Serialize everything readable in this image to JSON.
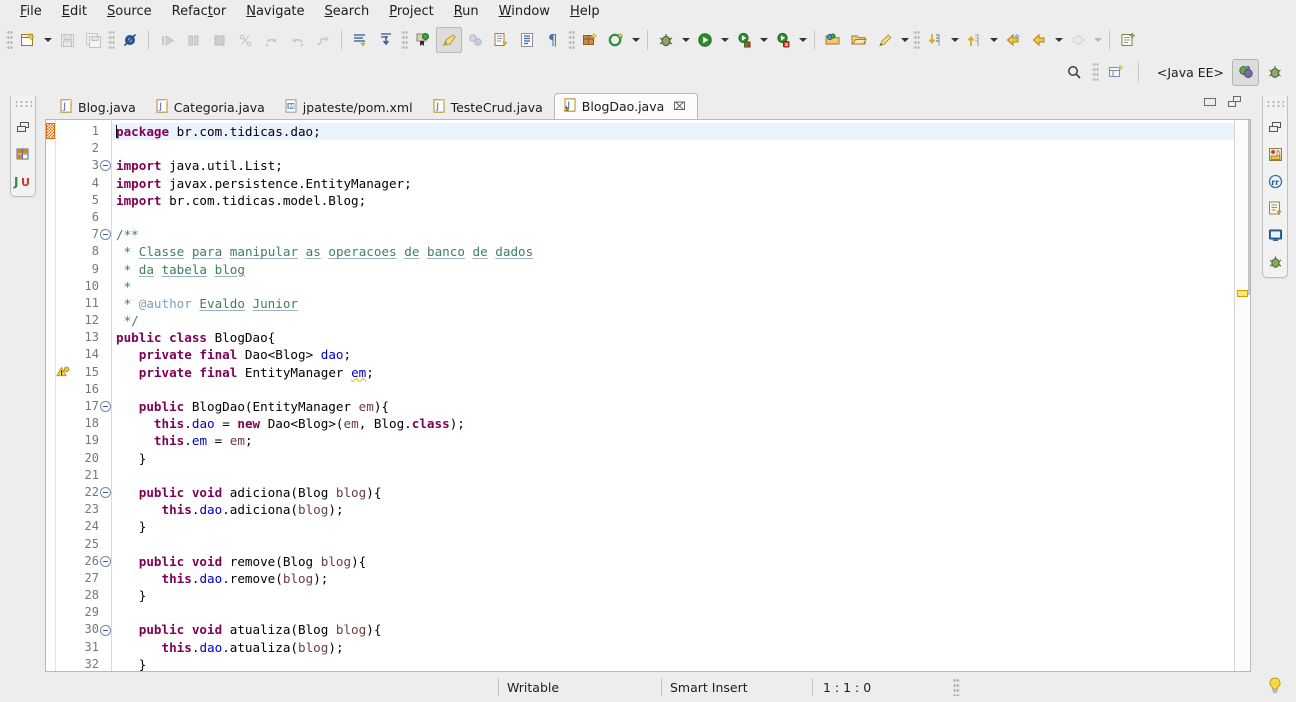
{
  "window": {
    "app": "Eclipse IDE",
    "perspective_label": "<Java EE>"
  },
  "menubar": {
    "items": [
      {
        "label": "File",
        "mnemonic": "F"
      },
      {
        "label": "Edit",
        "mnemonic": "E"
      },
      {
        "label": "Source",
        "mnemonic": "S"
      },
      {
        "label": "Refactor",
        "mnemonic": "t"
      },
      {
        "label": "Navigate",
        "mnemonic": "N"
      },
      {
        "label": "Search",
        "mnemonic": "S"
      },
      {
        "label": "Project",
        "mnemonic": "P"
      },
      {
        "label": "Run",
        "mnemonic": "R"
      },
      {
        "label": "Window",
        "mnemonic": "W"
      },
      {
        "label": "Help",
        "mnemonic": "H"
      }
    ]
  },
  "toolbar": {
    "groups": [
      {
        "name": "file",
        "buttons": [
          {
            "icon": "new-wizard-icon",
            "enabled": true,
            "dropdown": true
          },
          {
            "icon": "save-icon",
            "enabled": false
          },
          {
            "icon": "save-all-icon",
            "enabled": false
          }
        ]
      },
      {
        "name": "validate",
        "buttons": [
          {
            "icon": "skip-all-breakpoints-icon",
            "enabled": true
          }
        ]
      },
      {
        "name": "debug-controls",
        "buttons": [
          {
            "icon": "resume-icon",
            "enabled": false
          },
          {
            "icon": "suspend-icon",
            "enabled": false
          },
          {
            "icon": "terminate-icon",
            "enabled": false
          },
          {
            "icon": "step-into-icon",
            "enabled": false
          },
          {
            "icon": "step-over-icon",
            "enabled": false
          },
          {
            "icon": "step-return-icon",
            "enabled": false
          },
          {
            "icon": "drop-to-frame-icon",
            "enabled": false
          }
        ]
      },
      {
        "name": "annotations",
        "buttons": [
          {
            "icon": "next-annotation-icon",
            "enabled": true
          },
          {
            "icon": "previous-annotation-icon",
            "enabled": true
          }
        ]
      },
      {
        "name": "markers",
        "buttons": [
          {
            "icon": "add-bookmark-icon",
            "enabled": true
          },
          {
            "icon": "toggle-mark-occurrences-icon",
            "enabled": true,
            "selected": true
          },
          {
            "icon": "restore-last-selection-icon",
            "enabled": false
          },
          {
            "icon": "open-task-icon",
            "enabled": true
          },
          {
            "icon": "show-whitespace-icon",
            "enabled": true
          },
          {
            "icon": "show-print-margin-icon",
            "enabled": true
          }
        ]
      },
      {
        "name": "java",
        "buttons": [
          {
            "icon": "new-java-package-icon",
            "enabled": true
          },
          {
            "icon": "new-java-class-icon",
            "enabled": true,
            "dropdown": true
          }
        ]
      },
      {
        "name": "launch",
        "buttons": [
          {
            "icon": "debug-icon",
            "enabled": true,
            "dropdown": true
          },
          {
            "icon": "run-icon",
            "enabled": true,
            "dropdown": true
          },
          {
            "icon": "run-external-tools-icon",
            "enabled": true,
            "dropdown": true
          },
          {
            "icon": "profile-icon",
            "enabled": true,
            "dropdown": true
          }
        ]
      },
      {
        "name": "resources",
        "buttons": [
          {
            "icon": "open-type-icon",
            "enabled": true
          },
          {
            "icon": "open-task-resource-icon",
            "enabled": true
          },
          {
            "icon": "new-edit-icon",
            "enabled": true,
            "dropdown": true
          }
        ]
      },
      {
        "name": "navigation",
        "buttons": [
          {
            "icon": "next-edit-location-icon",
            "enabled": true,
            "dropdown": true
          },
          {
            "icon": "previous-edit-location-icon",
            "enabled": true,
            "dropdown": true
          },
          {
            "icon": "back-icon",
            "enabled": true
          },
          {
            "icon": "forward-icon",
            "enabled": true,
            "dropdown": true
          },
          {
            "icon": "forward-disabled-icon",
            "enabled": false,
            "dropdown": true
          }
        ]
      },
      {
        "name": "misc",
        "buttons": [
          {
            "icon": "new-annotation-icon",
            "enabled": true
          }
        ]
      }
    ]
  },
  "perspective_bar": {
    "search_icon": "search-icon",
    "open-perspective_icon": "open-perspective-icon",
    "label": "<Java EE>",
    "perspectives": [
      {
        "name": "java-ee-perspective",
        "icon": "java-ee-icon",
        "active": true
      },
      {
        "name": "debug-perspective",
        "icon": "debug-perspective-icon",
        "active": false
      }
    ]
  },
  "left_rail": {
    "icons": [
      {
        "name": "restore-view-icon"
      },
      {
        "name": "project-explorer-icon"
      },
      {
        "name": "junit-icon",
        "label": "JU"
      }
    ]
  },
  "right_rail": {
    "icons": [
      {
        "name": "restore-view-icon"
      },
      {
        "name": "task-list-icon"
      },
      {
        "name": "javadoc-icon"
      },
      {
        "name": "snippets-icon"
      },
      {
        "name": "console-icon"
      },
      {
        "name": "servers-icon"
      }
    ]
  },
  "editor": {
    "tabs": [
      {
        "label": "Blog.java",
        "icon": "java-file-icon",
        "active": false,
        "dirty": false
      },
      {
        "label": "Categoria.java",
        "icon": "java-file-icon",
        "active": false,
        "dirty": false
      },
      {
        "label": "jpateste/pom.xml",
        "icon": "maven-file-icon",
        "active": false,
        "dirty": false
      },
      {
        "label": "TesteCrud.java",
        "icon": "java-file-icon",
        "active": false,
        "dirty": false
      },
      {
        "label": "BlogDao.java",
        "icon": "java-file-warning-icon",
        "active": true,
        "dirty": false,
        "close_glyph": "⌧"
      }
    ],
    "controls": [
      {
        "name": "minimize-editor-button"
      },
      {
        "name": "maximize-editor-button"
      }
    ],
    "first_visible_line": 1,
    "last_visible_line": 32,
    "current_line": 1,
    "change_marker_line": 1,
    "warning_marker_line": 15,
    "fold_lines": [
      3,
      7,
      17,
      22,
      26,
      30
    ],
    "lines": [
      {
        "n": 1,
        "html": "<span class=\"caret\"></span><span class=\"kw\">package</span><span class=\"plain\"> br.com.tidicas.dao;</span>",
        "current": true
      },
      {
        "n": 2,
        "html": ""
      },
      {
        "n": 3,
        "html": "<span class=\"kw\">import</span><span class=\"plain\"> java.util.List;</span>",
        "fold": true
      },
      {
        "n": 4,
        "html": "<span class=\"kw\">import</span><span class=\"plain\"> javax.persistence.EntityManager;</span>"
      },
      {
        "n": 5,
        "html": "<span class=\"kw\">import</span><span class=\"plain\"> br.com.tidicas.model.Blog;</span>"
      },
      {
        "n": 6,
        "html": ""
      },
      {
        "n": 7,
        "html": "<span class=\"cmt\">/**</span>",
        "fold": true
      },
      {
        "n": 8,
        "html": "<span class=\"cmt\"> * </span><span class=\"cmt spellu\">Classe</span><span class=\"cmt\"> </span><span class=\"cmt spellu\">para</span><span class=\"cmt\"> </span><span class=\"cmt spellu\">manipular</span><span class=\"cmt\"> </span><span class=\"cmt spellu\">as</span><span class=\"cmt\"> </span><span class=\"cmt spellu\">operacoes</span><span class=\"cmt\"> </span><span class=\"cmt spellu\">de</span><span class=\"cmt\"> </span><span class=\"cmt spellu\">banco</span><span class=\"cmt\"> </span><span class=\"cmt spellu\">de</span><span class=\"cmt\"> </span><span class=\"cmt spellu\">dados</span>"
      },
      {
        "n": 9,
        "html": "<span class=\"cmt\"> * </span><span class=\"cmt spellu\">da</span><span class=\"cmt\"> </span><span class=\"cmt spellu\">tabela</span><span class=\"cmt\"> </span><span class=\"cmt spellu\">blog</span>"
      },
      {
        "n": 10,
        "html": "<span class=\"cmt\"> *</span>"
      },
      {
        "n": 11,
        "html": "<span class=\"cmt\"> * </span><span class=\"jdoc-tag\">@author</span><span class=\"cmt\"> </span><span class=\"cmt spellu\">Evaldo</span><span class=\"cmt\"> </span><span class=\"cmt spellu\">Junior</span>"
      },
      {
        "n": 12,
        "html": "<span class=\"cmt\"> */</span>"
      },
      {
        "n": 13,
        "html": "<span class=\"kw\">public class</span><span class=\"plain\"> BlogDao{</span>"
      },
      {
        "n": 14,
        "html": "<span class=\"plain\">   </span><span class=\"kw\">private final</span><span class=\"plain\"> Dao&lt;Blog&gt; </span><span class=\"fld\">dao</span><span class=\"plain\">;</span>"
      },
      {
        "n": 15,
        "html": "<span class=\"plain\">   </span><span class=\"kw\">private final</span><span class=\"plain\"> EntityManager </span><span class=\"fld warnu\">em</span><span class=\"plain\">;</span>",
        "warning": true
      },
      {
        "n": 16,
        "html": ""
      },
      {
        "n": 17,
        "html": "<span class=\"plain\">   </span><span class=\"kw\">public</span><span class=\"plain\"> BlogDao(EntityManager </span><span class=\"param\">em</span><span class=\"plain\">){</span>",
        "fold": true
      },
      {
        "n": 18,
        "html": "<span class=\"plain\">     </span><span class=\"kw\">this</span><span class=\"plain\">.</span><span class=\"fld\">dao</span><span class=\"plain\"> = </span><span class=\"kw\">new</span><span class=\"plain\"> Dao&lt;Blog&gt;(</span><span class=\"param\">em</span><span class=\"plain\">, Blog.</span><span class=\"kw\">class</span><span class=\"plain\">);</span>"
      },
      {
        "n": 19,
        "html": "<span class=\"plain\">     </span><span class=\"kw\">this</span><span class=\"plain\">.</span><span class=\"fld\">em</span><span class=\"plain\"> = </span><span class=\"param\">em</span><span class=\"plain\">;</span>"
      },
      {
        "n": 20,
        "html": "<span class=\"plain\">   }</span>"
      },
      {
        "n": 21,
        "html": ""
      },
      {
        "n": 22,
        "html": "<span class=\"plain\">   </span><span class=\"kw\">public void</span><span class=\"plain\"> adiciona(Blog </span><span class=\"param\">blog</span><span class=\"plain\">){</span>",
        "fold": true
      },
      {
        "n": 23,
        "html": "<span class=\"plain\">      </span><span class=\"kw\">this</span><span class=\"plain\">.</span><span class=\"fld\">dao</span><span class=\"plain\">.adiciona(</span><span class=\"param\">blog</span><span class=\"plain\">);</span>"
      },
      {
        "n": 24,
        "html": "<span class=\"plain\">   }</span>"
      },
      {
        "n": 25,
        "html": ""
      },
      {
        "n": 26,
        "html": "<span class=\"plain\">   </span><span class=\"kw\">public void</span><span class=\"plain\"> remove(Blog </span><span class=\"param\">blog</span><span class=\"plain\">){</span>",
        "fold": true
      },
      {
        "n": 27,
        "html": "<span class=\"plain\">      </span><span class=\"kw\">this</span><span class=\"plain\">.</span><span class=\"fld\">dao</span><span class=\"plain\">.remove(</span><span class=\"param\">blog</span><span class=\"plain\">);</span>"
      },
      {
        "n": 28,
        "html": "<span class=\"plain\">   }</span>"
      },
      {
        "n": 29,
        "html": ""
      },
      {
        "n": 30,
        "html": "<span class=\"plain\">   </span><span class=\"kw\">public void</span><span class=\"plain\"> atualiza(Blog </span><span class=\"param\">blog</span><span class=\"plain\">){</span>",
        "fold": true
      },
      {
        "n": 31,
        "html": "<span class=\"plain\">      </span><span class=\"kw\">this</span><span class=\"plain\">.</span><span class=\"fld\">dao</span><span class=\"plain\">.atualiza(</span><span class=\"param\">blog</span><span class=\"plain\">);</span>"
      },
      {
        "n": 32,
        "html": "<span class=\"plain\">   }</span>"
      }
    ],
    "source_text": "package br.com.tidicas.dao;\n\nimport java.util.List;\nimport javax.persistence.EntityManager;\nimport br.com.tidicas.model.Blog;\n\n/**\n * Classe para manipular as operacoes de banco de dados\n * da tabela blog\n *\n * @author Evaldo Junior\n */\npublic class BlogDao{\n   private final Dao<Blog> dao;\n   private final EntityManager em;\n\n   public BlogDao(EntityManager em){\n     this.dao = new Dao<Blog>(em, Blog.class);\n     this.em = em;\n   }\n\n   public void adiciona(Blog blog){\n      this.dao.adiciona(blog);\n   }\n\n   public void remove(Blog blog){\n      this.dao.remove(blog);\n   }\n\n   public void atualiza(Blog blog){\n      this.dao.atualiza(blog);\n   }"
  },
  "statusbar": {
    "writable": "Writable",
    "insert_mode": "Smart Insert",
    "position": "1 : 1 : 0",
    "tip_icon": "lightbulb-icon"
  },
  "colors": {
    "chrome": "#ededed",
    "editor_bg": "#ffffff",
    "current_line": "#eaf2fd",
    "keyword": "#7f0055",
    "comment": "#3f7f5f",
    "javadoc_tag": "#7f9fbf",
    "field": "#0000c0",
    "parameter": "#6a3e3e",
    "warning": "#ffe673",
    "change_marker": "#e8690b",
    "line_number": "#777777",
    "border": "#b9b9b9"
  }
}
